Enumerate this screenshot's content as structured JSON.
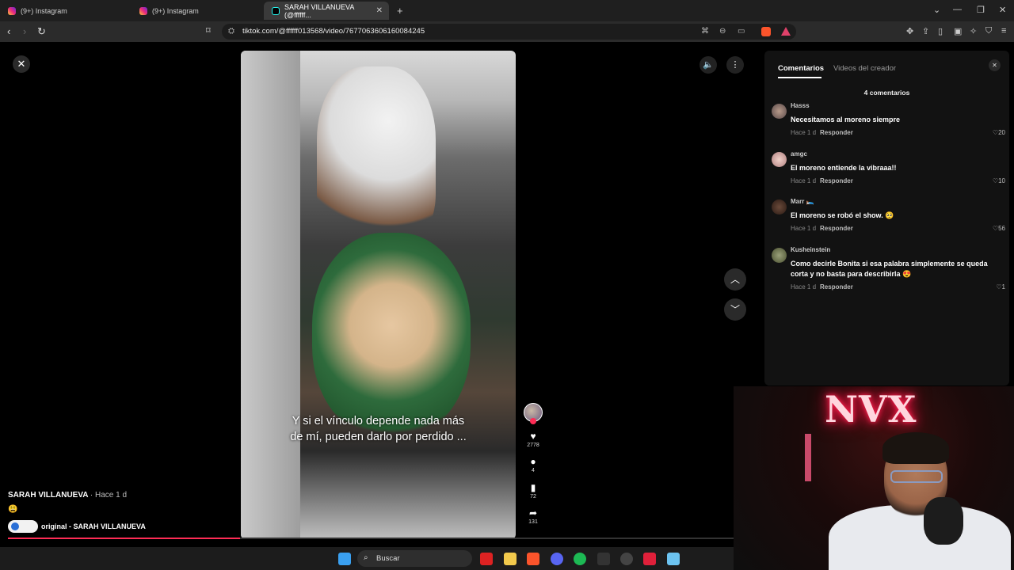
{
  "browser": {
    "tabs": [
      {
        "label": "(9+) Instagram"
      },
      {
        "label": "(9+) Instagram"
      },
      {
        "label": "SARAH VILLANUEVA (@ffffff..."
      }
    ],
    "url": "tiktok.com/@ffffff013568/video/7677063606160084245"
  },
  "video": {
    "caption": "Y si el vínculo depende nada más de mí, pueden darlo por perdido ...",
    "author": "SARAH VILLANUEVA",
    "time_ago": "· Hace 1 d",
    "description_emoji": "😩",
    "sound": "original - SARAH VILLANUEVA",
    "progress": 0.32,
    "likes": "2778",
    "comments": "4",
    "saves": "72",
    "shares": "131"
  },
  "panel": {
    "tab_comments": "Comentarios",
    "tab_creator_videos": "Videos del creador",
    "count_label": "4 comentarios",
    "comments": [
      {
        "user": "Hasss",
        "text": "Necesitamos al moreno siempre",
        "time": "Hace 1 d",
        "reply": "Responder",
        "likes": "20"
      },
      {
        "user": "amgc",
        "text": "El moreno entiende la vibraaa!!",
        "time": "Hace 1 d",
        "reply": "Responder",
        "likes": "10"
      },
      {
        "user": "Marr 🛌",
        "text": "El moreno se robó el show. 🥺",
        "time": "Hace 1 d",
        "reply": "Responder",
        "likes": "56"
      },
      {
        "user": "Kusheinstein",
        "text": "Como decirle Bonita si esa palabra simplemente se queda corta y no basta para describirla 😍",
        "time": "Hace 1 d",
        "reply": "Responder",
        "likes": "1"
      }
    ]
  },
  "webcam": {
    "sign": "NVX"
  },
  "taskbar": {
    "search_label": "Buscar"
  },
  "colors": {
    "accent": "#fe2c55",
    "panel_bg": "#121212"
  }
}
